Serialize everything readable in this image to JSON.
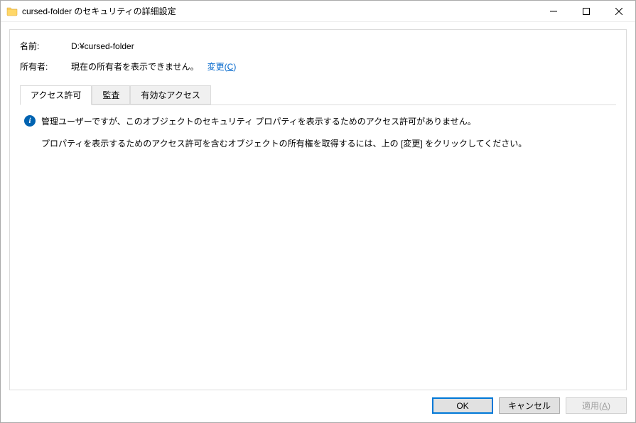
{
  "window": {
    "title": "cursed-folder のセキュリティの詳細設定"
  },
  "header": {
    "name_label": "名前:",
    "name_value": "D:¥cursed-folder",
    "owner_label": "所有者:",
    "owner_value": "現在の所有者を表示できません。",
    "change_prefix": "変更",
    "change_paren_open": "(",
    "change_key": "C",
    "change_paren_close": ")"
  },
  "tabs": {
    "permissions": "アクセス許可",
    "auditing": "監査",
    "effective": "有効なアクセス"
  },
  "body": {
    "info_line": "管理ユーザーですが、このオブジェクトのセキュリティ プロパティを表示するためのアクセス許可がありません。",
    "hint_line": "プロパティを表示するためのアクセス許可を含むオブジェクトの所有権を取得するには、上の [変更] をクリックしてください。"
  },
  "buttons": {
    "ok": "OK",
    "cancel": "キャンセル",
    "apply_prefix": "適用",
    "apply_paren_open": "(",
    "apply_key": "A",
    "apply_paren_close": ")"
  }
}
